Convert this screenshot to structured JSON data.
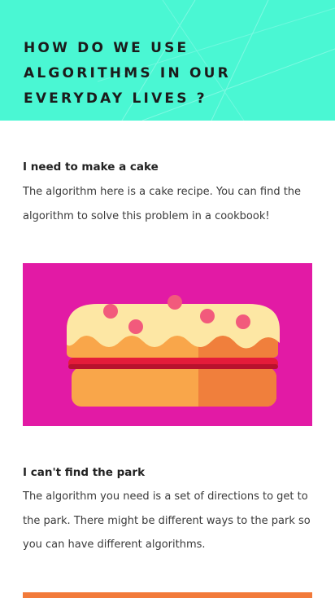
{
  "hero": {
    "title": "HOW DO WE USE ALGORITHMS IN OUR EVERYDAY LIVES ?",
    "background": "#4af7d3"
  },
  "sections": [
    {
      "title": "I need to make a cake",
      "body": "The algorithm here is a cake recipe. You can find the algorithm to solve this problem in a cookbook!",
      "image": {
        "icon": "cake-illustration",
        "background": "#e21aa5"
      }
    },
    {
      "title": "I can't find the park",
      "body": "The algorithm you need is a set of directions to get to the park. There might be different ways to the park so you can have different algorithms.",
      "image": {
        "background": "#f27a3a"
      }
    }
  ]
}
